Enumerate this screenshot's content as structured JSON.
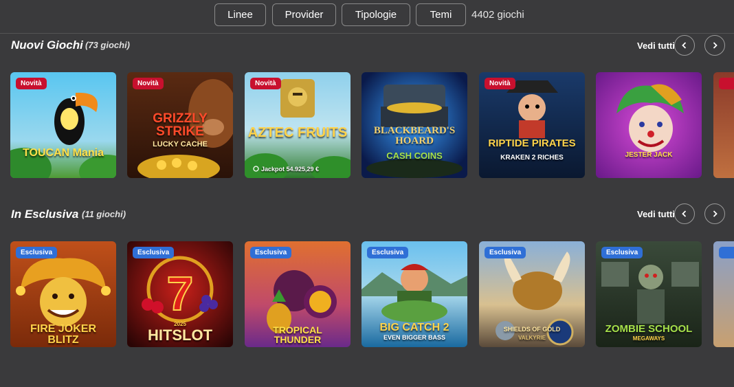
{
  "filters": {
    "linee": "Linee",
    "provider": "Provider",
    "tipologie": "Tipologie",
    "temi": "Temi",
    "total_count": "4402 giochi"
  },
  "sections": [
    {
      "title": "Nuovi Giochi",
      "count": "(73 giochi)",
      "see_all": "Vedi tutti",
      "games": [
        {
          "badge": "Novità",
          "title": "TOUCAN Mania"
        },
        {
          "badge": "Novità",
          "title": "GRIZZLY STRIKE",
          "subtitle": "LUCKY CACHE"
        },
        {
          "badge": "Novità",
          "title": "AZTEC FRUITS",
          "jackpot": "Jackpot 54.925,29 €"
        },
        {
          "badge": "",
          "title": "BLACKBEARD'S HOARD",
          "subtitle": "CASH COINS"
        },
        {
          "badge": "Novità",
          "title": "RIPTIDE PIRATES",
          "subtitle": "KRAKEN 2 RICHES"
        },
        {
          "badge": "",
          "title": "JESTER JACK"
        }
      ]
    },
    {
      "title": "In Esclusiva",
      "count": "(11 giochi)",
      "see_all": "Vedi tutti",
      "games": [
        {
          "badge": "Esclusiva",
          "title": "FIRE JOKER BLITZ"
        },
        {
          "badge": "Esclusiva",
          "title": "HITSLOT",
          "subtitle": "2025"
        },
        {
          "badge": "Esclusiva",
          "title": "TROPICAL THUNDER"
        },
        {
          "badge": "Esclusiva",
          "title": "BIG CATCH 2",
          "subtitle": "EVEN BIGGER BASS"
        },
        {
          "badge": "Esclusiva",
          "title": "SHIELDS OF GOLD",
          "subtitle": "VALKYRIE"
        },
        {
          "badge": "Esclusiva",
          "title": "ZOMBIE SCHOOL",
          "subtitle": "MEGAWAYS"
        }
      ]
    }
  ],
  "icons": {
    "prev": "chevron-left-icon",
    "next": "chevron-right-icon",
    "jackpot": "coin-icon"
  },
  "colors": {
    "background": "#3a3a3c",
    "badge_new": "#c8102e",
    "badge_exclusive": "#2f6fd6"
  }
}
